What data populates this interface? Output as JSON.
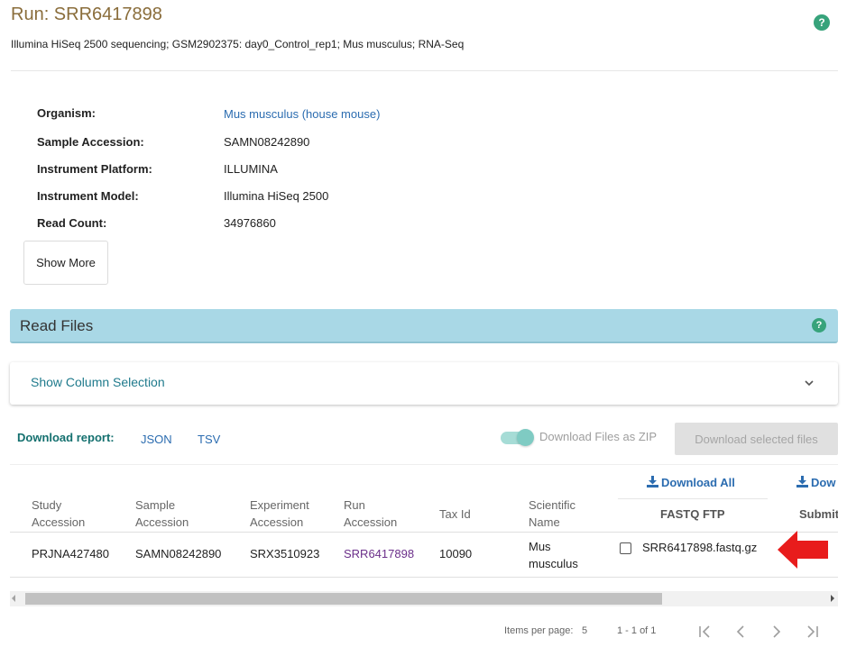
{
  "header": {
    "title": "Run: SRR6417898",
    "subtitle": "Illumina HiSeq 2500 sequencing; GSM2902375: day0_Control_rep1; Mus musculus; RNA-Seq",
    "help_glyph": "?"
  },
  "details": {
    "organism_label": "Organism:",
    "organism_value": "Mus musculus (house mouse)",
    "sample_accession_label": "Sample Accession:",
    "sample_accession_value": "SAMN08242890",
    "instrument_platform_label": "Instrument Platform:",
    "instrument_platform_value": "ILLUMINA",
    "instrument_model_label": "Instrument Model:",
    "instrument_model_value": "Illumina HiSeq 2500",
    "read_count_label": "Read Count:",
    "read_count_value": "34976860",
    "show_more_label": "Show More"
  },
  "read_files": {
    "title": "Read Files",
    "help_glyph": "?",
    "column_selection_label": "Show Column Selection"
  },
  "download": {
    "report_label": "Download report:",
    "json_label": "JSON",
    "tsv_label": "TSV",
    "zip_toggle_label": "Download Files as ZIP",
    "zip_toggle_on": true,
    "download_selected_label": "Download selected files"
  },
  "table": {
    "headers": {
      "study_accession": [
        "Study",
        "Accession"
      ],
      "sample_accession": [
        "Sample",
        "Accession"
      ],
      "experiment_accession": [
        "Experiment",
        "Accession"
      ],
      "run_accession": [
        "Run",
        "Accession"
      ],
      "tax_id": "Tax Id",
      "scientific_name": [
        "Scientific",
        "Name"
      ],
      "fastq_download_all": "Download All",
      "fastq_ftp": "FASTQ FTP",
      "submitted_download": "Dow",
      "submitted": "Submit"
    },
    "row": {
      "study_accession": "PRJNA427480",
      "sample_accession": "SAMN08242890",
      "experiment_accession": "SRX3510923",
      "run_accession": "SRR6417898",
      "tax_id": "10090",
      "scientific_name": [
        "Mus",
        "musculus"
      ],
      "fastq_file": "SRR6417898.fastq.gz"
    }
  },
  "paginator": {
    "items_per_page_label": "Items per page:",
    "items_per_page_value": "5",
    "range_label": "1 - 1 of 1"
  },
  "colors": {
    "title": "#8a6d3b",
    "link": "#2b6cb0",
    "help_icon": "#37a37b",
    "read_files_bar": "#a9d8e6",
    "annotation_arrow": "#e81c1c",
    "run_accession_link": "#6b2f8a"
  },
  "icons": {
    "help": "question-circle-icon",
    "chevron": "chevron-down-icon",
    "download": "download-icon",
    "arrow": "red-arrow-annotation"
  }
}
